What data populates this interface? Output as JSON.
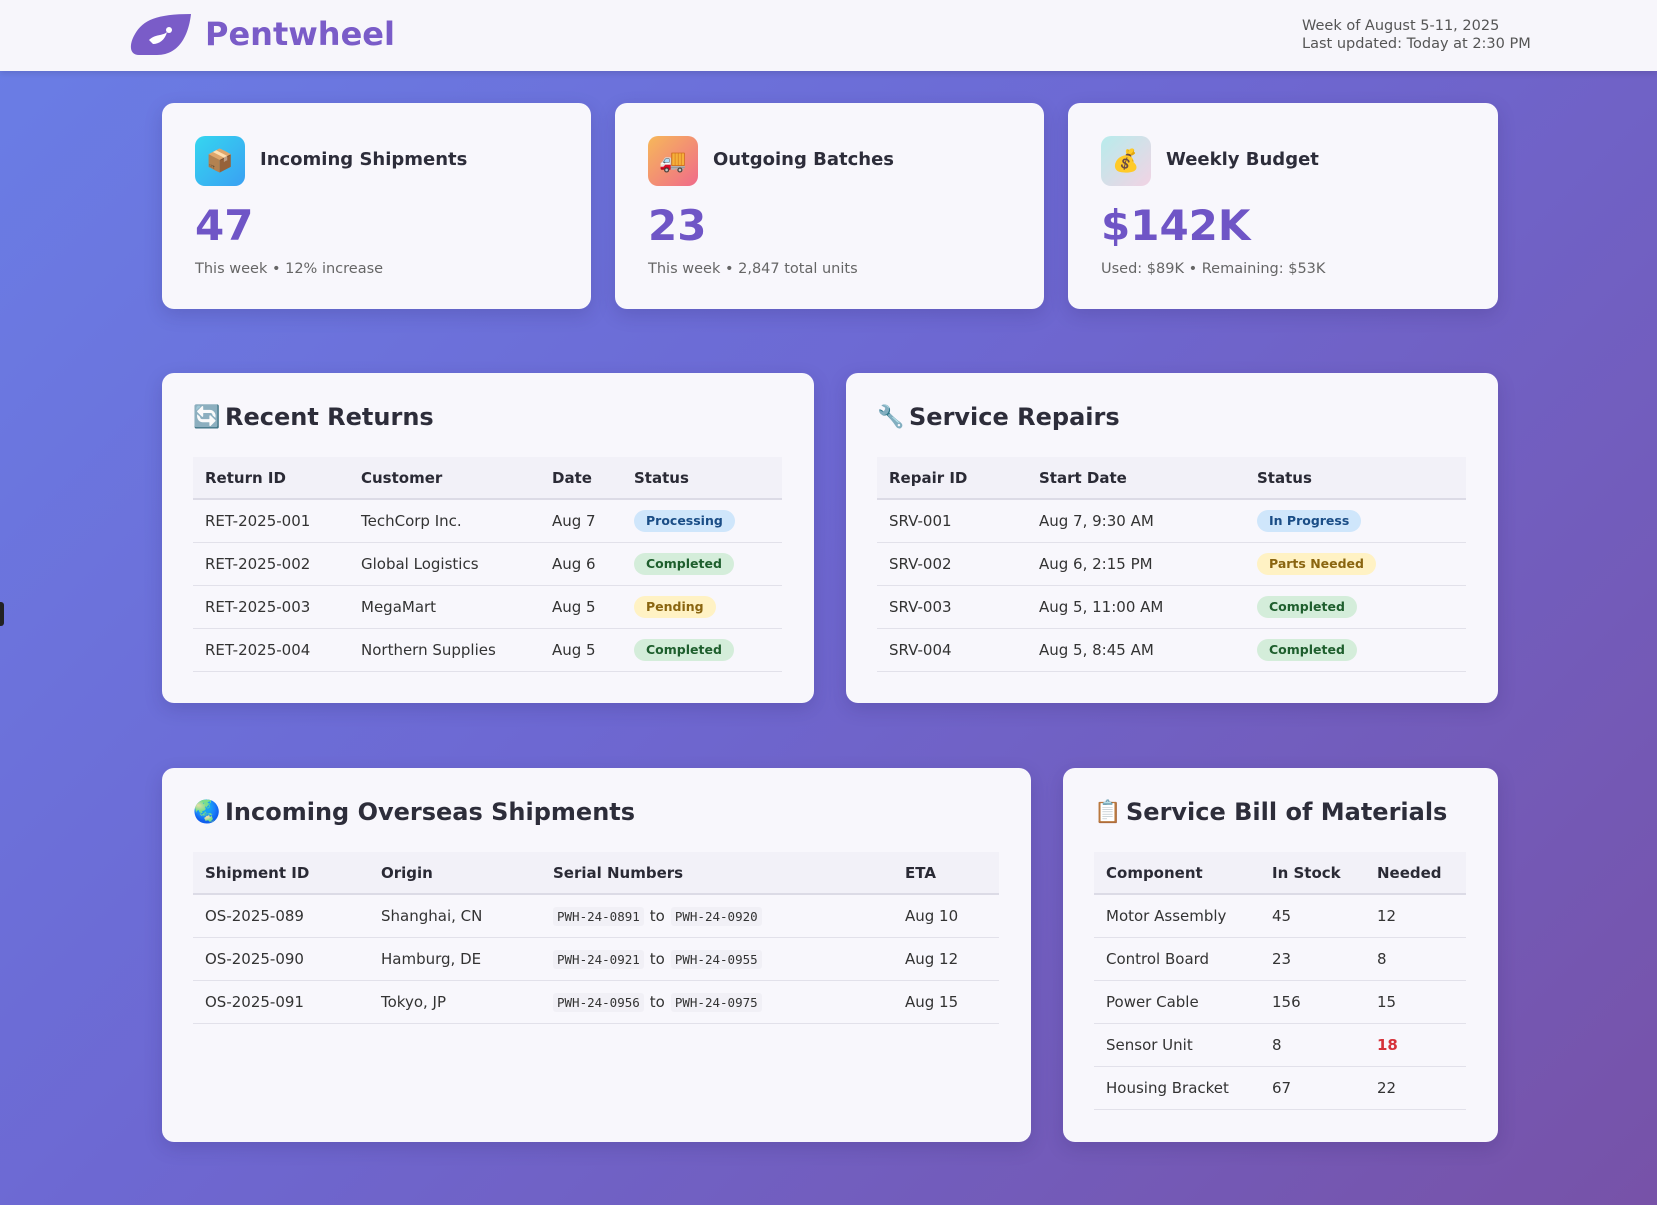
{
  "header": {
    "brand": "Pentwheel",
    "week": "Week of August 5-11, 2025",
    "updated": "Last updated: Today at 2:30 PM"
  },
  "stats": [
    {
      "icon": "package-icon",
      "title": "Incoming Shipments",
      "value": "47",
      "sub": "This week • 12% increase"
    },
    {
      "icon": "truck-icon",
      "title": "Outgoing Batches",
      "value": "23",
      "sub": "This week • 2,847 total units"
    },
    {
      "icon": "money-bag-icon",
      "title": "Weekly Budget",
      "value": "$142K",
      "sub": "Used: $89K • Remaining: $53K"
    }
  ],
  "returns": {
    "title": "Recent Returns",
    "headers": [
      "Return ID",
      "Customer",
      "Date",
      "Status"
    ],
    "rows": [
      {
        "id": "RET-2025-001",
        "customer": "TechCorp Inc.",
        "date": "Aug 7",
        "status": "Processing"
      },
      {
        "id": "RET-2025-002",
        "customer": "Global Logistics",
        "date": "Aug 6",
        "status": "Completed"
      },
      {
        "id": "RET-2025-003",
        "customer": "MegaMart",
        "date": "Aug 5",
        "status": "Pending"
      },
      {
        "id": "RET-2025-004",
        "customer": "Northern Supplies",
        "date": "Aug 5",
        "status": "Completed"
      }
    ]
  },
  "repairs": {
    "title": "Service Repairs",
    "headers": [
      "Repair ID",
      "Start Date",
      "Status"
    ],
    "rows": [
      {
        "id": "SRV-001",
        "start": "Aug 7, 9:30 AM",
        "status": "In Progress"
      },
      {
        "id": "SRV-002",
        "start": "Aug 6, 2:15 PM",
        "status": "Parts Needed"
      },
      {
        "id": "SRV-003",
        "start": "Aug 5, 11:00 AM",
        "status": "Completed"
      },
      {
        "id": "SRV-004",
        "start": "Aug 5, 8:45 AM",
        "status": "Completed"
      }
    ]
  },
  "overseas": {
    "title": "Incoming Overseas Shipments",
    "headers": [
      "Shipment ID",
      "Origin",
      "Serial Numbers",
      "ETA"
    ],
    "to_word": "to",
    "rows": [
      {
        "id": "OS-2025-089",
        "origin": "Shanghai, CN",
        "serial_from": "PWH-24-0891",
        "serial_to": "PWH-24-0920",
        "eta": "Aug 10"
      },
      {
        "id": "OS-2025-090",
        "origin": "Hamburg, DE",
        "serial_from": "PWH-24-0921",
        "serial_to": "PWH-24-0955",
        "eta": "Aug 12"
      },
      {
        "id": "OS-2025-091",
        "origin": "Tokyo, JP",
        "serial_from": "PWH-24-0956",
        "serial_to": "PWH-24-0975",
        "eta": "Aug 15"
      }
    ]
  },
  "bom": {
    "title": "Service Bill of Materials",
    "headers": [
      "Component",
      "In Stock",
      "Needed"
    ],
    "rows": [
      {
        "component": "Motor Assembly",
        "stock": "45",
        "needed": "12"
      },
      {
        "component": "Control Board",
        "stock": "23",
        "needed": "8"
      },
      {
        "component": "Power Cable",
        "stock": "156",
        "needed": "15"
      },
      {
        "component": "Sensor Unit",
        "stock": "8",
        "needed": "18"
      },
      {
        "component": "Housing Bracket",
        "stock": "67",
        "needed": "22"
      }
    ]
  }
}
